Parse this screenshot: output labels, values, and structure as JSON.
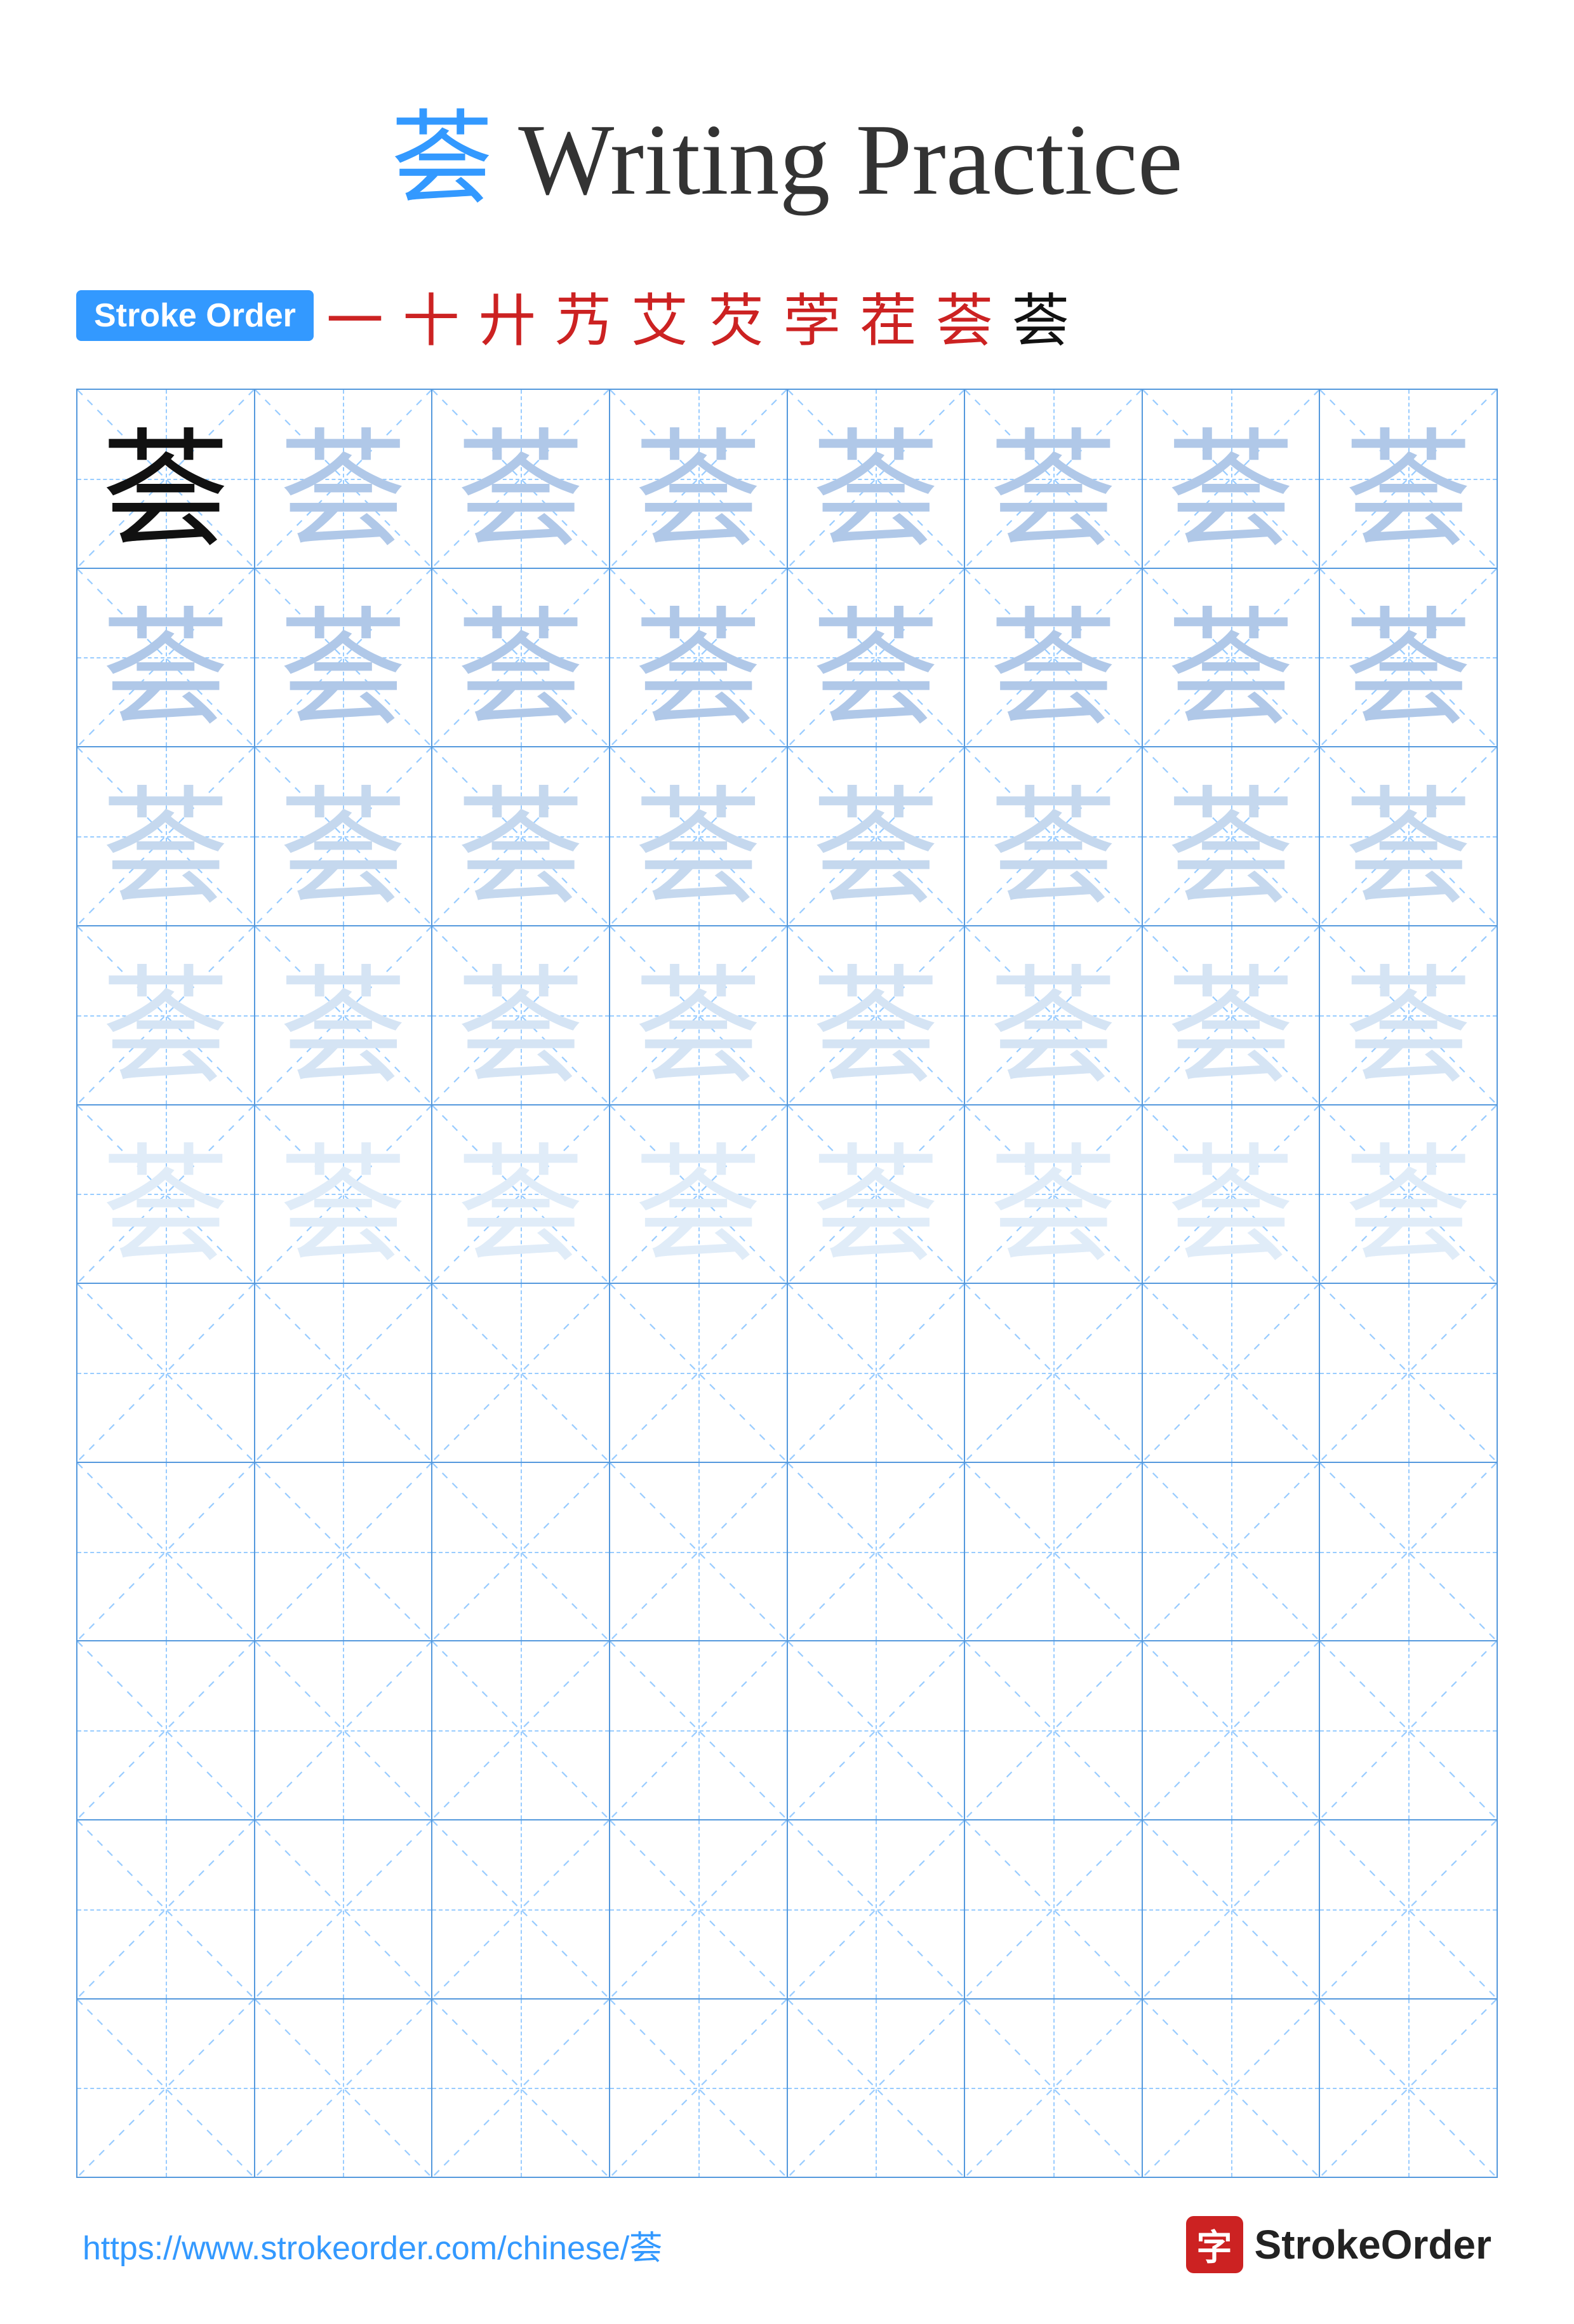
{
  "title": {
    "char": "荟",
    "text": " Writing Practice"
  },
  "stroke_order": {
    "badge_label": "Stroke Order",
    "strokes": [
      "一",
      "十",
      "廾",
      "艿",
      "艾",
      "芡",
      "茡",
      "茬",
      "荟",
      "荟"
    ]
  },
  "grid": {
    "rows": 10,
    "cols": 8,
    "char": "荟",
    "filled_rows": 5,
    "empty_rows": 5,
    "fade_levels": [
      "dark",
      "fade1",
      "fade1",
      "fade1",
      "fade2",
      "fade2",
      "fade2",
      "fade2",
      "fade3",
      "fade3",
      "fade3",
      "fade3",
      "fade4",
      "fade4",
      "fade4",
      "fade4",
      "fade4",
      "fade4",
      "fade4",
      "fade4",
      "fade4",
      "fade4",
      "fade4",
      "fade4",
      "fade4",
      "fade4",
      "fade4",
      "fade4",
      "fade4",
      "fade4",
      "fade4",
      "fade4",
      "fade4",
      "fade4",
      "fade4",
      "fade4",
      "fade4",
      "fade4",
      "fade4",
      "fade4"
    ]
  },
  "footer": {
    "url": "https://www.strokeorder.com/chinese/荟",
    "brand_char": "字",
    "brand_name": "StrokeOrder"
  }
}
